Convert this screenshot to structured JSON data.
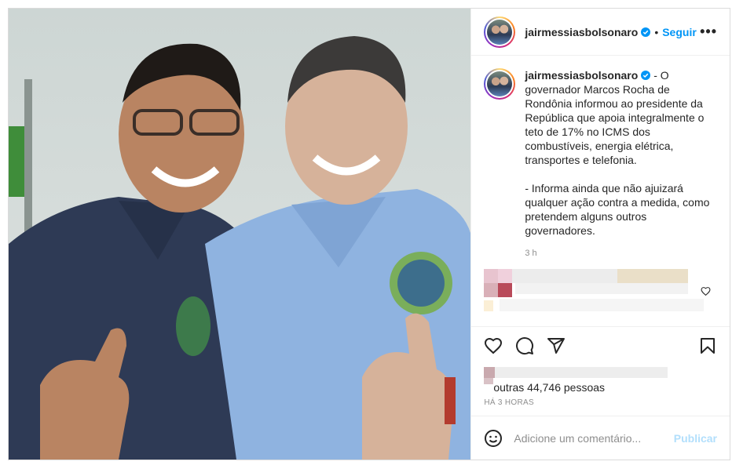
{
  "header": {
    "username": "jairmessiasbolsonaro",
    "dot": "•",
    "follow_label": "Seguir",
    "more_label": "•••"
  },
  "caption": {
    "username": "jairmessiasbolsonaro",
    "text": " - O governador Marcos Rocha de Rondônia informou ao presidente da República que apoia integralmente o teto de 17% no ICMS dos combustíveis, energia elétrica, transportes e telefonia.\n\n- Informa ainda que não ajuizará qualquer ação contra a medida, como pretendem alguns outros governadores.",
    "time": "3 h"
  },
  "likes": {
    "text": "outras 44,746 pessoas"
  },
  "timestamp": "HÁ 3 HORAS",
  "comment": {
    "placeholder": "Adicione um comentário...",
    "publish_label": "Publicar"
  },
  "colors": {
    "accent": "#0095f6",
    "publish_disabled": "#b2dffc",
    "muted": "#8e8e8e",
    "border": "#dbdbdb"
  },
  "icons": {
    "header": [
      "verified-badge-icon",
      "more-options-icon"
    ],
    "actions": [
      "heart-icon",
      "comment-icon",
      "share-icon",
      "bookmark-icon"
    ],
    "comment": [
      "emoji-icon"
    ]
  }
}
